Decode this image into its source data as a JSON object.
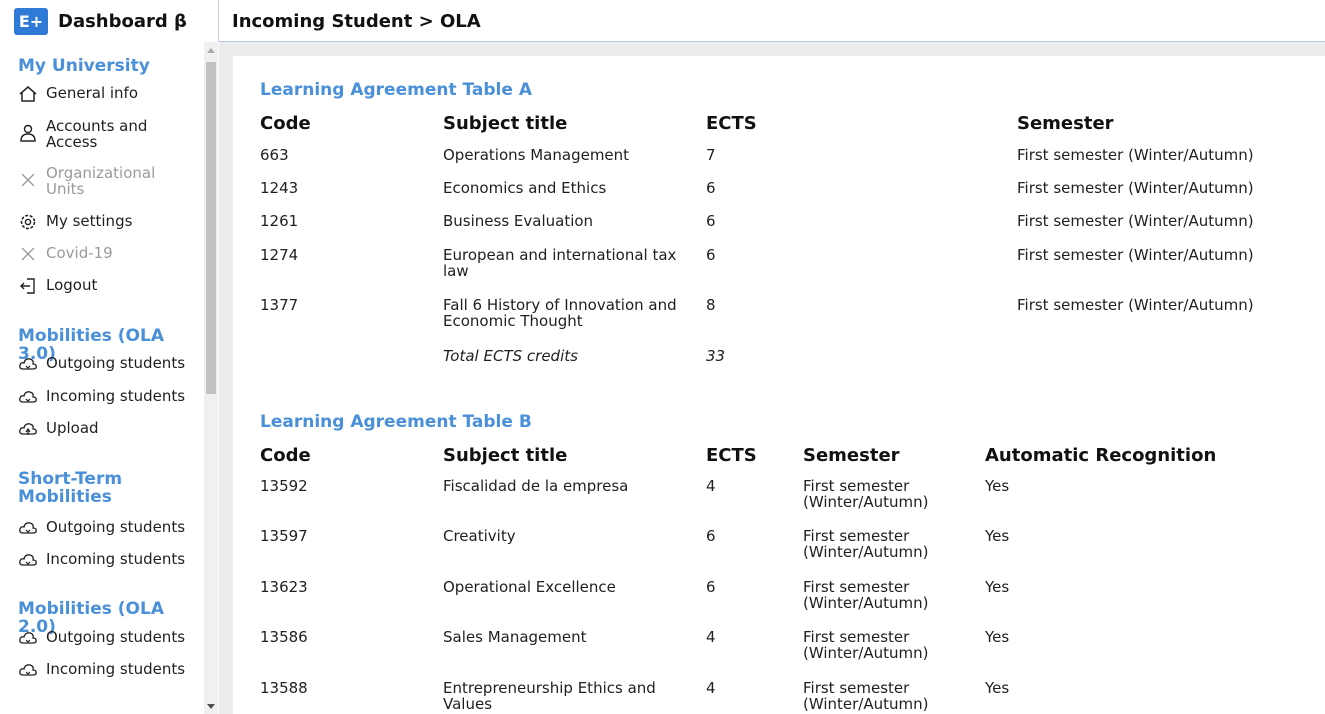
{
  "app": {
    "logo_text": "E+",
    "title": "Dashboard β"
  },
  "header": {
    "breadcrumb": "Incoming Student > OLA"
  },
  "sidebar": {
    "my_university": {
      "title": "My University",
      "items": [
        {
          "label": "General info",
          "icon": "home-icon",
          "disabled": false
        },
        {
          "label": "Accounts and Access",
          "icon": "user-icon",
          "disabled": false
        },
        {
          "label": "Organizational Units",
          "icon": "close-icon",
          "disabled": true
        },
        {
          "label": "My settings",
          "icon": "gear-icon",
          "disabled": false
        },
        {
          "label": "Covid-19",
          "icon": "close-icon",
          "disabled": true
        },
        {
          "label": "Logout",
          "icon": "logout-icon",
          "disabled": false
        }
      ]
    },
    "mobilities_ola3": {
      "title": "Mobilities (OLA 3.0)",
      "items": [
        {
          "label": "Outgoing students",
          "icon": "cloud-icon"
        },
        {
          "label": "Incoming students",
          "icon": "cloud-icon"
        },
        {
          "label": "Upload",
          "icon": "cloud-upload-icon"
        }
      ]
    },
    "short_term": {
      "title": "Short-Term Mobilities",
      "items": [
        {
          "label": "Outgoing students",
          "icon": "cloud-icon"
        },
        {
          "label": "Incoming students",
          "icon": "cloud-icon"
        }
      ]
    },
    "mobilities_ola2": {
      "title": "Mobilities (OLA 2.0)",
      "items": [
        {
          "label": "Outgoing students",
          "icon": "cloud-icon"
        },
        {
          "label": "Incoming students",
          "icon": "cloud-icon"
        }
      ]
    }
  },
  "table_a": {
    "title": "Learning Agreement Table A",
    "headers": {
      "code": "Code",
      "subject": "Subject title",
      "ects": "ECTS",
      "semester": "Semester"
    },
    "rows": [
      {
        "code": "663",
        "subject": "Operations Management",
        "ects": "7",
        "semester": "First semester (Winter/Autumn)"
      },
      {
        "code": "1243",
        "subject": "Economics and Ethics",
        "ects": "6",
        "semester": "First semester (Winter/Autumn)"
      },
      {
        "code": "1261",
        "subject": "Business Evaluation",
        "ects": "6",
        "semester": "First semester (Winter/Autumn)"
      },
      {
        "code": "1274",
        "subject": "European and international tax law",
        "ects": "6",
        "semester": "First semester (Winter/Autumn)"
      },
      {
        "code": "1377",
        "subject": "Fall 6 History of Innovation and Economic Thought",
        "ects": "8",
        "semester": "First semester (Winter/Autumn)"
      }
    ],
    "total_label": "Total ECTS credits",
    "total_value": "33"
  },
  "table_b": {
    "title": "Learning Agreement Table B",
    "headers": {
      "code": "Code",
      "subject": "Subject title",
      "ects": "ECTS",
      "semester": "Semester",
      "recognition": "Automatic Recognition"
    },
    "rows": [
      {
        "code": "13592",
        "subject": "Fiscalidad de la empresa",
        "ects": "4",
        "semester": "First semester (Winter/Autumn)",
        "recognition": "Yes"
      },
      {
        "code": "13597",
        "subject": "Creativity",
        "ects": "6",
        "semester": "First semester (Winter/Autumn)",
        "recognition": "Yes"
      },
      {
        "code": "13623",
        "subject": "Operational Excellence",
        "ects": "6",
        "semester": "First semester (Winter/Autumn)",
        "recognition": "Yes"
      },
      {
        "code": "13586",
        "subject": "Sales Management",
        "ects": "4",
        "semester": "First semester (Winter/Autumn)",
        "recognition": "Yes"
      },
      {
        "code": "13588",
        "subject": "Entrepreneurship Ethics and Values",
        "ects": "4",
        "semester": "First semester (Winter/Autumn)",
        "recognition": "Yes"
      }
    ]
  },
  "colors": {
    "accent": "#4a90d9",
    "logo": "#2e7ad6",
    "panel_bg": "#ececec"
  }
}
